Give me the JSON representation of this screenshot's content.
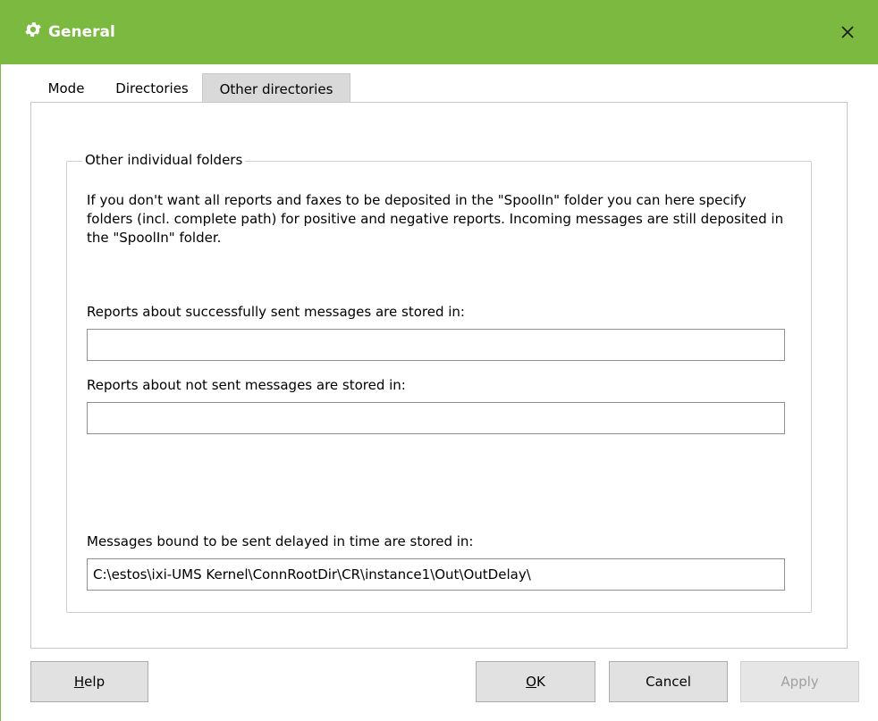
{
  "window": {
    "title": "General",
    "title_icon": "gear-icon",
    "close_icon": "close-icon",
    "title_bar_color": "#7cb940"
  },
  "tabs": [
    {
      "label": "Mode",
      "active": false
    },
    {
      "label": "Directories",
      "active": false
    },
    {
      "label": "Other directories",
      "active": true
    }
  ],
  "group": {
    "legend": "Other individual folders",
    "description": "If you don't want all reports and faxes to be deposited in the \"SpoolIn\" folder you can here specify folders (incl. complete path) for positive and negative reports. Incoming messages are still deposited in the \"SpoolIn\" folder."
  },
  "fields": {
    "success_label": "Reports about successfully sent messages are stored in:",
    "success_value": "",
    "notsent_label": "Reports about not sent messages are stored in:",
    "notsent_value": "",
    "delayed_label": "Messages bound to be sent delayed in time are stored in:",
    "delayed_value": "C:\\estos\\ixi-UMS Kernel\\ConnRootDir\\CR\\instance1\\Out\\OutDelay\\"
  },
  "buttons": {
    "help_mnemonic": "H",
    "help_rest": "elp",
    "ok_mnemonic": "O",
    "ok_rest": "K",
    "cancel": "Cancel",
    "apply": "Apply"
  }
}
